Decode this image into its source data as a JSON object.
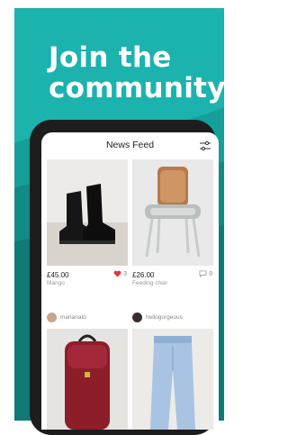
{
  "headline": {
    "line1": "Join the",
    "line2": "community"
  },
  "feed": {
    "title": "News Feed",
    "items": [
      {
        "price": "£45.00",
        "description": "Mango",
        "favourites": "3",
        "favourited": true
      },
      {
        "price": "£26.00",
        "description": "Feeding chair",
        "favourites": "9",
        "favourited": false
      }
    ],
    "users": [
      {
        "username": "marianato"
      },
      {
        "username": "hellogorgeous"
      }
    ]
  },
  "colors": {
    "brand": "#1cb3ae",
    "heart": "#e8343d"
  }
}
